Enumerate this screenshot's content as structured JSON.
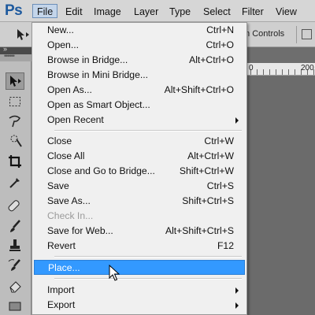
{
  "app": {
    "logo": "Ps"
  },
  "menubar": {
    "items": [
      "File",
      "Edit",
      "Image",
      "Layer",
      "Type",
      "Select",
      "Filter",
      "View"
    ]
  },
  "options_bar": {
    "transform_controls": "m Controls"
  },
  "ruler": {
    "marks": [
      "0",
      "200"
    ]
  },
  "file_menu": {
    "items": [
      {
        "label": "New...",
        "shortcut": "Ctrl+N"
      },
      {
        "label": "Open...",
        "shortcut": "Ctrl+O"
      },
      {
        "label": "Browse in Bridge...",
        "shortcut": "Alt+Ctrl+O"
      },
      {
        "label": "Browse in Mini Bridge...",
        "shortcut": ""
      },
      {
        "label": "Open As...",
        "shortcut": "Alt+Shift+Ctrl+O"
      },
      {
        "label": "Open as Smart Object...",
        "shortcut": ""
      },
      {
        "label": "Open Recent",
        "shortcut": "",
        "submenu": true
      },
      {
        "label": "Close",
        "shortcut": "Ctrl+W"
      },
      {
        "label": "Close All",
        "shortcut": "Alt+Ctrl+W"
      },
      {
        "label": "Close and Go to Bridge...",
        "shortcut": "Shift+Ctrl+W"
      },
      {
        "label": "Save",
        "shortcut": "Ctrl+S"
      },
      {
        "label": "Save As...",
        "shortcut": "Shift+Ctrl+S"
      },
      {
        "label": "Check In...",
        "shortcut": "",
        "disabled": true
      },
      {
        "label": "Save for Web...",
        "shortcut": "Alt+Shift+Ctrl+S"
      },
      {
        "label": "Revert",
        "shortcut": "F12"
      },
      {
        "label": "Place...",
        "shortcut": "",
        "highlighted": true
      },
      {
        "label": "Import",
        "shortcut": "",
        "submenu": true
      },
      {
        "label": "Export",
        "shortcut": "",
        "submenu": true
      }
    ]
  },
  "tools": [
    "move-tool-icon",
    "marquee-tool-icon",
    "lasso-tool-icon",
    "quick-selection-tool-icon",
    "crop-tool-icon",
    "eyedropper-tool-icon",
    "healing-brush-tool-icon",
    "brush-tool-icon",
    "clone-stamp-tool-icon",
    "history-brush-tool-icon",
    "eraser-tool-icon"
  ],
  "colors": {
    "highlight": "#3399ff",
    "menu_bg": "#f0f0f0",
    "logo": "#1e5a9e"
  }
}
